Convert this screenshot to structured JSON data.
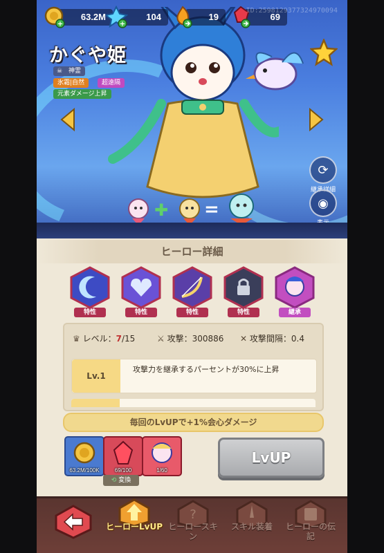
{
  "currencies": [
    {
      "name": "gold",
      "value": "63.2M"
    },
    {
      "name": "crystal",
      "value": "104"
    },
    {
      "name": "flame",
      "value": "19"
    },
    {
      "name": "ruby",
      "value": "69"
    }
  ],
  "uid": "ID:2598129377324970094",
  "hero": {
    "name": "かぐや姫",
    "rank": "神霊",
    "tags": [
      "氷霜|自然",
      "超遠隔",
      "元素ダメージ上昇"
    ]
  },
  "side_buttons": {
    "inherit_detail": "継承詳細",
    "display": "表示"
  },
  "panel": {
    "title": "ヒーロー詳細",
    "traits": [
      {
        "label": "特性",
        "icon": "crescent-icon",
        "color": "#3d4bc4"
      },
      {
        "label": "特性",
        "icon": "heart-crest-icon",
        "color": "#6a52d6"
      },
      {
        "label": "特性",
        "icon": "bow-icon",
        "color": "#5a3fa8"
      },
      {
        "label": "特性",
        "icon": "lock-icon",
        "color": "#3a3e5a"
      },
      {
        "label": "継承",
        "icon": "inherit-portrait-icon",
        "color": "#c24ec0"
      }
    ],
    "stats": {
      "level_label": "レベル：",
      "level_value": "7",
      "level_max": "/15",
      "attack_label": "攻撃：",
      "attack_value": "300886",
      "interval_label": "攻撃間隔：",
      "interval_value": "0.4"
    },
    "level_row": {
      "badge": "Lv.1",
      "text": "攻撃力を継承するパーセントが30%に上昇"
    },
    "bonus": "毎回のLvUPで+1%会心ダメージ",
    "items": [
      {
        "icon": "gold-coin-icon",
        "count": "63.2M/100K"
      },
      {
        "icon": "red-gem-icon",
        "count": "69/100"
      },
      {
        "icon": "hero-shard-icon",
        "count": "1/60"
      }
    ],
    "convert_label": "変換",
    "lvup_label": "LvUP"
  },
  "nav": [
    {
      "label": "ヒーローLvUP",
      "active": true
    },
    {
      "label": "ヒーロースキン",
      "active": false
    },
    {
      "label": "スキル装着",
      "active": false
    },
    {
      "label": "ヒーローの伝記",
      "active": false
    }
  ],
  "colors": {
    "accent": "#f1d98e",
    "panel_bg": "#efe8d8",
    "nav_bg": "#5a3530"
  }
}
